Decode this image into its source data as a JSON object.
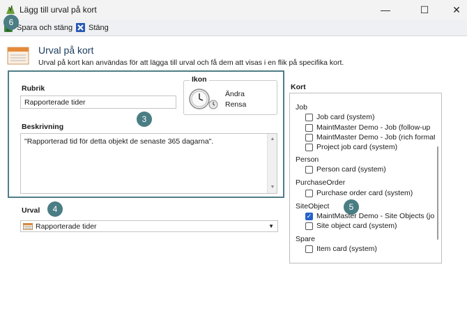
{
  "window": {
    "title": "Lägg till urval på kort",
    "minimize_glyph": "—",
    "maximize_glyph": "☐",
    "close_glyph": "✕"
  },
  "toolbar": {
    "save_label": "Spara och stäng",
    "close_label": "Stäng"
  },
  "header": {
    "title": "Urval på kort",
    "description": "Urval på kort kan användas för att lägga till urval och få dem att visas i en flik på specifika kort."
  },
  "form": {
    "rubrik_label": "Rubrik",
    "rubrik_value": "Rapporterade tider",
    "ikon_label": "Ikon",
    "ikon_change": "Ändra",
    "ikon_clear": "Rensa",
    "beskrivning_label": "Beskrivning",
    "beskrivning_value": "\"Rapporterad tid för detta objekt de senaste 365 dagarna\".",
    "urval_label": "Urval",
    "urval_value": "Rapporterade tider"
  },
  "kort": {
    "label": "Kort",
    "groups": [
      {
        "name": "Job",
        "items": [
          {
            "label": "Job card (system)",
            "checked": false
          },
          {
            "label": "MaintMaster Demo - Job (follow-up",
            "checked": false
          },
          {
            "label": "MaintMaster Demo - Job (rich format",
            "checked": false
          },
          {
            "label": "Project job card (system)",
            "checked": false
          }
        ]
      },
      {
        "name": "Person",
        "items": [
          {
            "label": "Person card (system)",
            "checked": false
          }
        ]
      },
      {
        "name": "PurchaseOrder",
        "items": [
          {
            "label": "Purchase order card (system)",
            "checked": false
          }
        ]
      },
      {
        "name": "SiteObject",
        "items": [
          {
            "label": "MaintMaster Demo - Site Objects (jol",
            "checked": true
          },
          {
            "label": "Site object card (system)",
            "checked": false
          }
        ]
      },
      {
        "name": "Spare",
        "items": [
          {
            "label": "Item card (system)",
            "checked": false
          }
        ]
      }
    ]
  },
  "badges": {
    "b6": "6",
    "b3": "3",
    "b4": "4",
    "b5": "5"
  },
  "colors": {
    "badge": "#4a7d84",
    "panel_border": "#4f7d85",
    "checkbox_checked": "#2563c7"
  }
}
